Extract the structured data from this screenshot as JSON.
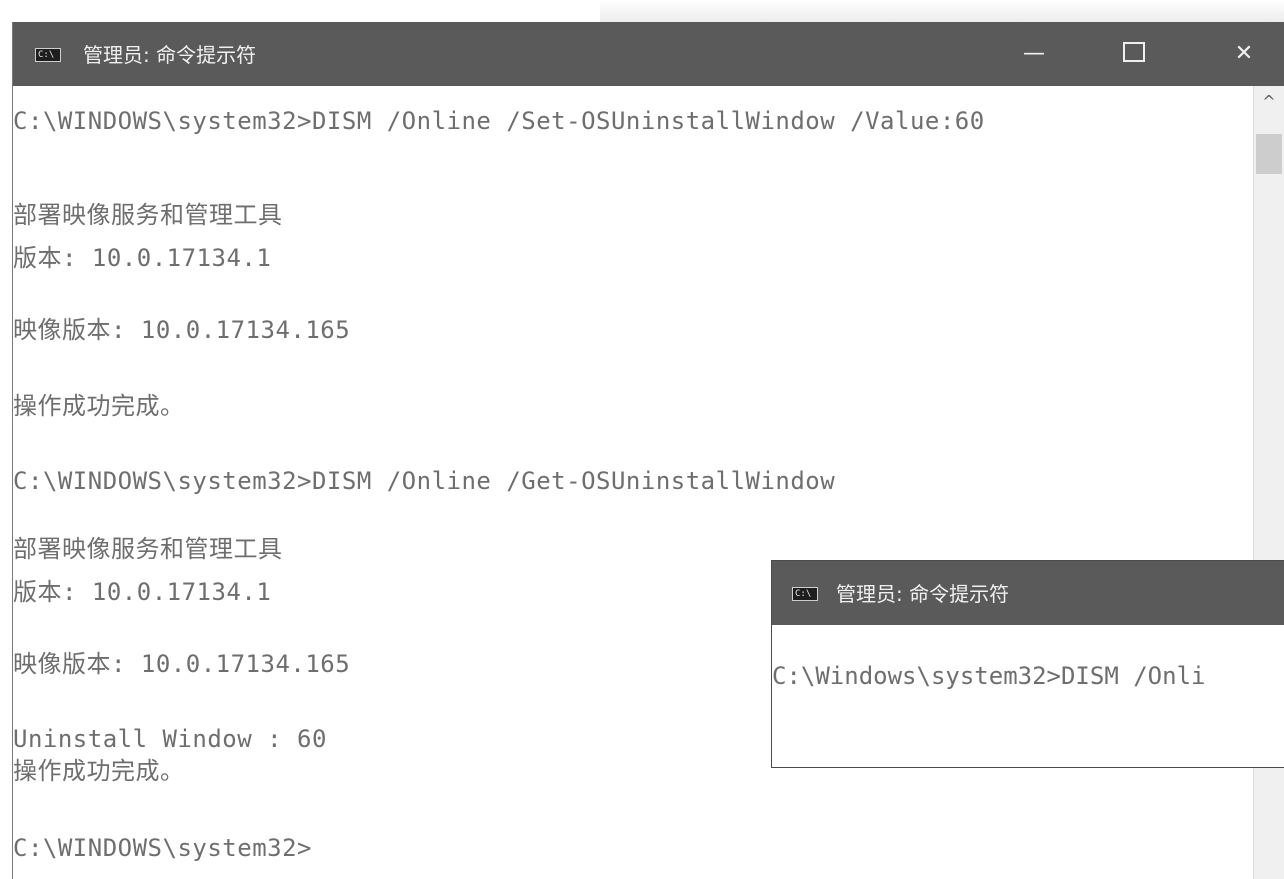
{
  "main_window": {
    "title": "管理员: 命令提示符",
    "icon": "cmd-icon",
    "controls": {
      "minimize_icon": "—",
      "close_icon": "✕"
    },
    "lines": [
      "C:\\WINDOWS\\system32>DISM /Online /Set-OSUninstallWindow /Value:60",
      "部署映像服务和管理工具",
      "版本: 10.0.17134.1",
      "映像版本: 10.0.17134.165",
      "操作成功完成。",
      "C:\\WINDOWS\\system32>DISM /Online /Get-OSUninstallWindow",
      "部署映像服务和管理工具",
      "版本: 10.0.17134.1",
      "映像版本: 10.0.17134.165",
      "Uninstall Window : 60",
      "操作成功完成。",
      "C:\\WINDOWS\\system32>"
    ],
    "scrollbar": {
      "up_arrow": "^"
    }
  },
  "overlay_window": {
    "title": "管理员: 命令提示符",
    "icon": "cmd-icon",
    "line": "C:\\Windows\\system32>DISM /Onli"
  },
  "colors": {
    "titlebar": "#5a5a5a",
    "console_text": "#6e6e6e",
    "background": "#ffffff"
  }
}
